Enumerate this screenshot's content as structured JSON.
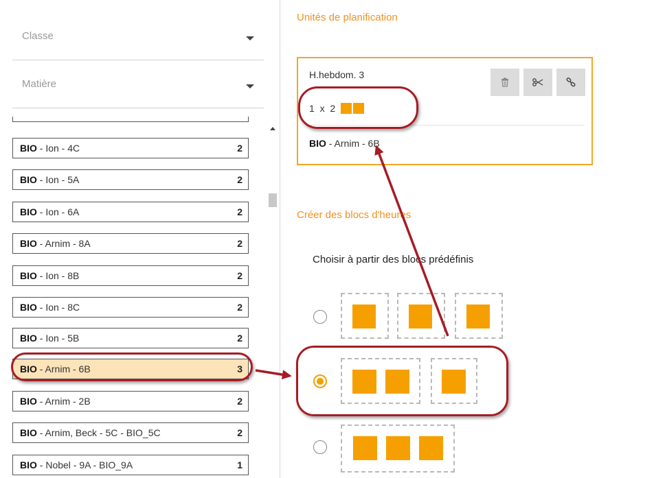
{
  "filters": {
    "class_label": "Classe",
    "subject_label": "Matière"
  },
  "list": [
    {
      "subject": "BIO",
      "rest": " - Ion - 4C",
      "count": "2"
    },
    {
      "subject": "BIO",
      "rest": " - Ion - 5A",
      "count": "2"
    },
    {
      "subject": "BIO",
      "rest": " - Ion - 6A",
      "count": "2"
    },
    {
      "subject": "BIO",
      "rest": " - Arnim - 8A",
      "count": "2"
    },
    {
      "subject": "BIO",
      "rest": " - Ion - 8B",
      "count": "2"
    },
    {
      "subject": "BIO",
      "rest": " - Ion - 8C",
      "count": "2"
    },
    {
      "subject": "BIO",
      "rest": " - Ion - 5B",
      "count": "2"
    },
    {
      "subject": "BIO",
      "rest": " - Arnim - 6B",
      "count": "3",
      "selected": true
    },
    {
      "subject": "BIO",
      "rest": " - Arnim - 2B",
      "count": "2"
    },
    {
      "subject": "BIO",
      "rest": " - Arnim, Beck - 5C - BIO_5C",
      "count": "2"
    },
    {
      "subject": "BIO",
      "rest": " - Nobel - 9A - BIO_9A",
      "count": "1"
    }
  ],
  "planning": {
    "title": "Unités de planification",
    "hours": "H.hebdom. 3",
    "count": "1",
    "times": "x",
    "length": "2",
    "unit_subject": "BIO",
    "unit_rest": " - Arnim - 6B",
    "delete_icon": "trash-icon",
    "split_icon": "scissors-icon",
    "link_icon": "link-icon"
  },
  "blocks": {
    "title": "Créer des blocs d'heures",
    "choose_label": "Choisir à partir des blocs prédéfinis",
    "options": [
      {
        "groups": [
          1,
          1,
          1
        ],
        "selected": false
      },
      {
        "groups": [
          2,
          1
        ],
        "selected": true
      },
      {
        "groups": [
          3
        ],
        "selected": false
      }
    ]
  },
  "colors": {
    "accent": "#f5a000",
    "title": "#f0921e",
    "selected_row": "#fde3b8",
    "highlight": "#a61c24"
  }
}
